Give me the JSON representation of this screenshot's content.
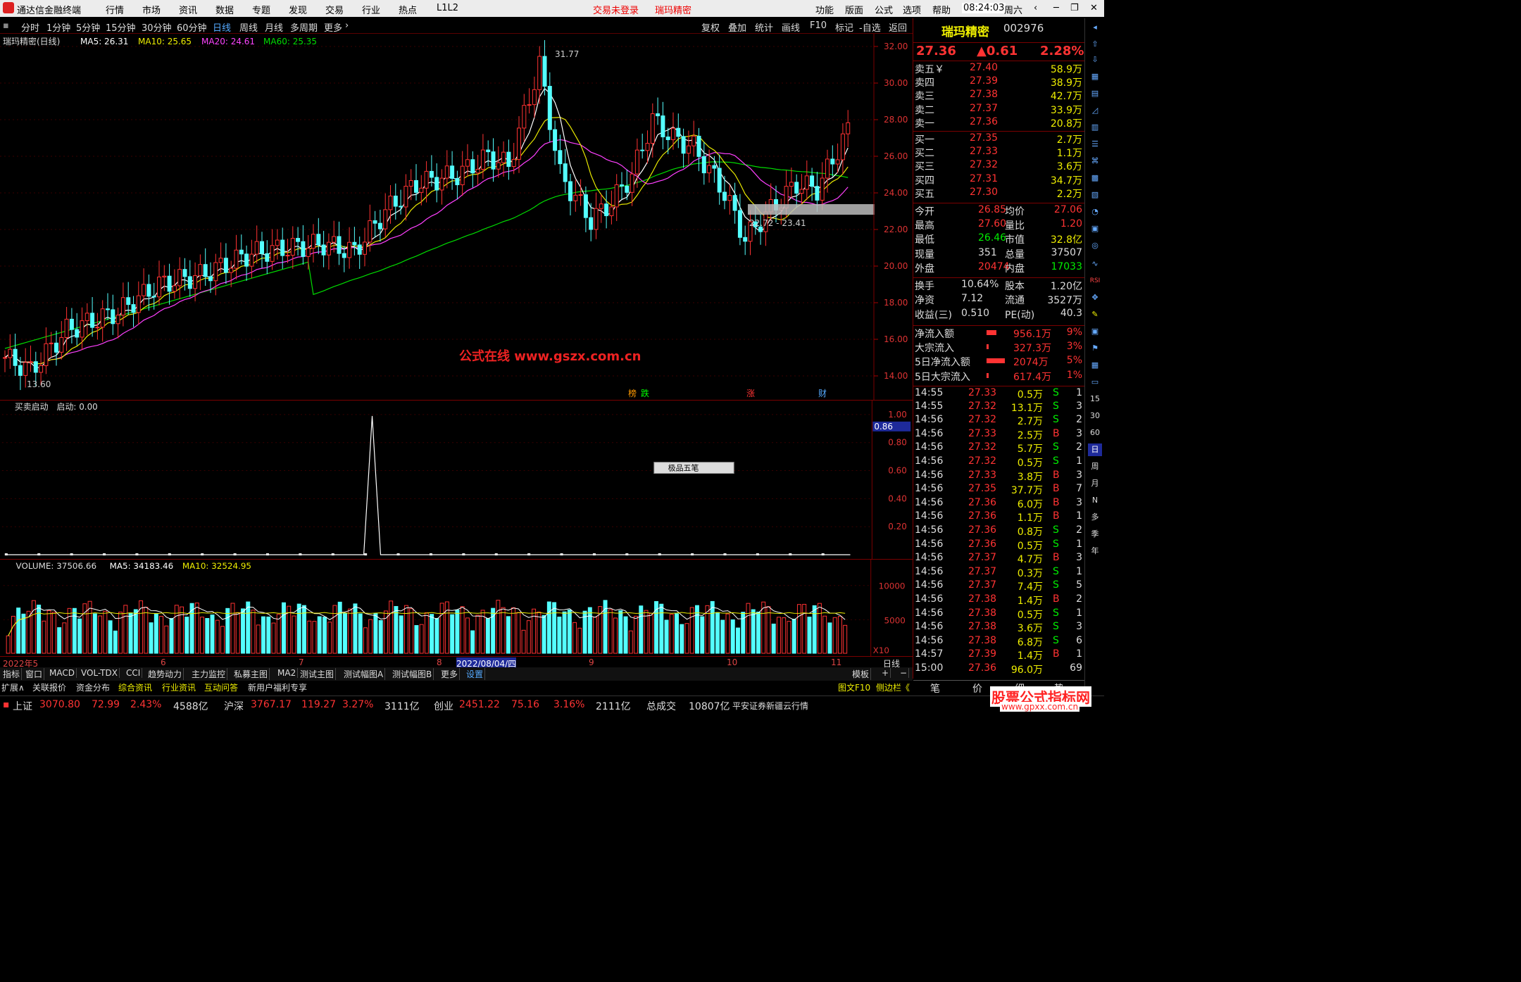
{
  "app": {
    "title": "通达信金融终端",
    "menu": [
      "行情",
      "市场",
      "资讯",
      "数据",
      "专题",
      "发现",
      "交易",
      "行业",
      "热点",
      "L1L2"
    ],
    "trade_status": "交易未登录",
    "stock_name_title": "瑞玛精密",
    "right_menu": [
      "功能",
      "版面",
      "公式",
      "选项",
      "帮助"
    ],
    "time": "08:24:03",
    "weekday": "周六"
  },
  "periods": [
    "分时",
    "1分钟",
    "5分钟",
    "15分钟",
    "30分钟",
    "60分钟",
    "日线",
    "周线",
    "月线",
    "多周期",
    "更多"
  ],
  "active_period": "日线",
  "tools": [
    "复权",
    "叠加",
    "统计",
    "画线",
    "F10",
    "标记",
    "-自选",
    "返回"
  ],
  "ma_legend": {
    "name": "瑞玛精密(日线)",
    "ma5": "MA5: 26.31",
    "ma10": "MA10: 25.65",
    "ma20": "MA20: 24.61",
    "ma60": "MA60: 25.35"
  },
  "price_axis": [
    "32.00",
    "30.00",
    "28.00",
    "26.00",
    "24.00",
    "22.00",
    "20.00",
    "18.00",
    "16.00",
    "14.00"
  ],
  "annotations": {
    "high": "31.77",
    "low": "13.60",
    "zone": "22.72 - 23.41",
    "watermark": "公式在线  www.gszx.com.cn",
    "events": [
      "榜",
      "跌",
      "涨",
      "财"
    ]
  },
  "indicator": {
    "title": "买卖启动",
    "value_label": "启动: 0.00",
    "axis": [
      "1.00",
      "0.80",
      "0.60",
      "0.40",
      "0.20"
    ],
    "cursor_value": "0.86",
    "toolbar": "极品五笔"
  },
  "volume": {
    "title": "VOLUME: 37506.66",
    "ma5": "MA5: 34183.46",
    "ma10": "MA10: 32524.95",
    "axis": [
      "10000",
      "5000"
    ],
    "unit": "X10"
  },
  "x_axis": {
    "labels": [
      "2022年5",
      "6",
      "7",
      "8",
      "9",
      "10",
      "11"
    ],
    "cursor_date": "2022/08/04/四",
    "period": "日线"
  },
  "bottom_tabs": [
    "指标",
    "窗口",
    "MACD",
    "VOL-TDX",
    "CCI",
    "趋势动力",
    "主力监控",
    "私募主图",
    "MA2",
    "测试主图",
    "测试幅图A",
    "测试幅图B",
    "更多",
    "设置"
  ],
  "bottom_tabs2": [
    "扩展∧",
    "关联报价",
    "资金分布",
    "综合资讯",
    "行业资讯",
    "互动问答",
    "新用户福利专享"
  ],
  "template_label": "模板",
  "right_tabs": [
    "图文F10",
    "侧边栏《",
    "笔",
    "价",
    "细",
    "势"
  ],
  "quote": {
    "name": "瑞玛精密",
    "code": "002976",
    "price": "27.36",
    "change": "▲0.61",
    "pct": "2.28%",
    "asks": [
      {
        "label": "卖五￥",
        "price": "27.40",
        "vol": "58.9万"
      },
      {
        "label": "卖四",
        "price": "27.39",
        "vol": "38.9万"
      },
      {
        "label": "卖三",
        "price": "27.38",
        "vol": "42.7万"
      },
      {
        "label": "卖二",
        "price": "27.37",
        "vol": "33.9万"
      },
      {
        "label": "卖一",
        "price": "27.36",
        "vol": "20.8万"
      }
    ],
    "bids": [
      {
        "label": "买一",
        "price": "27.35",
        "vol": "2.7万"
      },
      {
        "label": "买二",
        "price": "27.33",
        "vol": "1.1万"
      },
      {
        "label": "买三",
        "price": "27.32",
        "vol": "3.6万"
      },
      {
        "label": "买四",
        "price": "27.31",
        "vol": "34.7万"
      },
      {
        "label": "买五",
        "price": "27.30",
        "vol": "2.2万"
      }
    ],
    "stats": [
      [
        "今开",
        "26.85",
        "均价",
        "27.06"
      ],
      [
        "最高",
        "27.60",
        "量比",
        "1.20"
      ],
      [
        "最低",
        "26.46",
        "市值",
        "32.8亿"
      ],
      [
        "现量",
        "351",
        "总量",
        "37507"
      ],
      [
        "外盘",
        "20474",
        "内盘",
        "17033"
      ]
    ],
    "stats2": [
      [
        "换手",
        "10.64%",
        "股本",
        "1.20亿"
      ],
      [
        "净资",
        "7.12",
        "流通",
        "3527万"
      ],
      [
        "收益(三)",
        "0.510",
        "PE(动)",
        "40.3"
      ]
    ],
    "flows": [
      [
        "净流入额",
        "956.1万",
        "9%"
      ],
      [
        "大宗流入",
        "327.3万",
        "3%"
      ],
      [
        "5日净流入额",
        "2074万",
        "5%"
      ],
      [
        "5日大宗流入",
        "617.4万",
        "1%"
      ]
    ]
  },
  "ticks": [
    [
      "14:55",
      "27.33",
      "0.5万",
      "S",
      "1"
    ],
    [
      "14:55",
      "27.32",
      "13.1万",
      "S",
      "3"
    ],
    [
      "14:56",
      "27.32",
      "2.7万",
      "S",
      "2"
    ],
    [
      "14:56",
      "27.33",
      "2.5万",
      "B",
      "3"
    ],
    [
      "14:56",
      "27.32",
      "5.7万",
      "S",
      "2"
    ],
    [
      "14:56",
      "27.32",
      "0.5万",
      "S",
      "1"
    ],
    [
      "14:56",
      "27.33",
      "3.8万",
      "B",
      "3"
    ],
    [
      "14:56",
      "27.35",
      "37.7万",
      "B",
      "7"
    ],
    [
      "14:56",
      "27.36",
      "6.0万",
      "B",
      "3"
    ],
    [
      "14:56",
      "27.36",
      "1.1万",
      "B",
      "1"
    ],
    [
      "14:56",
      "27.36",
      "0.8万",
      "S",
      "2"
    ],
    [
      "14:56",
      "27.36",
      "0.5万",
      "S",
      "1"
    ],
    [
      "14:56",
      "27.37",
      "4.7万",
      "B",
      "3"
    ],
    [
      "14:56",
      "27.37",
      "0.3万",
      "S",
      "1"
    ],
    [
      "14:56",
      "27.37",
      "7.4万",
      "S",
      "5"
    ],
    [
      "14:56",
      "27.38",
      "1.4万",
      "B",
      "2"
    ],
    [
      "14:56",
      "27.38",
      "0.5万",
      "S",
      "1"
    ],
    [
      "14:56",
      "27.38",
      "3.6万",
      "S",
      "3"
    ],
    [
      "14:56",
      "27.38",
      "6.8万",
      "S",
      "6"
    ],
    [
      "14:57",
      "27.39",
      "1.4万",
      "B",
      "1"
    ],
    [
      "15:00",
      "27.36",
      "96.0万",
      "",
      "69"
    ]
  ],
  "side_icons": [
    "RSI",
    "15",
    "30",
    "60",
    "日",
    "周",
    "月",
    "N",
    "多",
    "季",
    "年"
  ],
  "statusbar": {
    "sh_name": "上证",
    "sh_val": "3070.80",
    "sh_chg": "72.99",
    "sh_pct": "2.43%",
    "sh_amt": "4588亿",
    "sz_name": "沪深",
    "sz_val": "3767.17",
    "sz_chg": "119.27",
    "sz_pct": "3.27%",
    "sz_amt": "3111亿",
    "cy_name": "创业",
    "cy_val": "2451.22",
    "cy_chg": "75.16",
    "cy_pct": "3.16%",
    "cy_amt": "2111亿",
    "total_label": "总成交",
    "total": "10807亿",
    "broker": "平安证券新疆云行情",
    "logo": "股票公式指标网",
    "logo_url": "www.gpxx.com.cn"
  },
  "colors": {
    "up": "#ff3232",
    "down": "#54ffff",
    "ma5": "#ffffff",
    "ma10": "#e8e800",
    "ma20": "#ff40ff",
    "ma60": "#00dd00"
  }
}
